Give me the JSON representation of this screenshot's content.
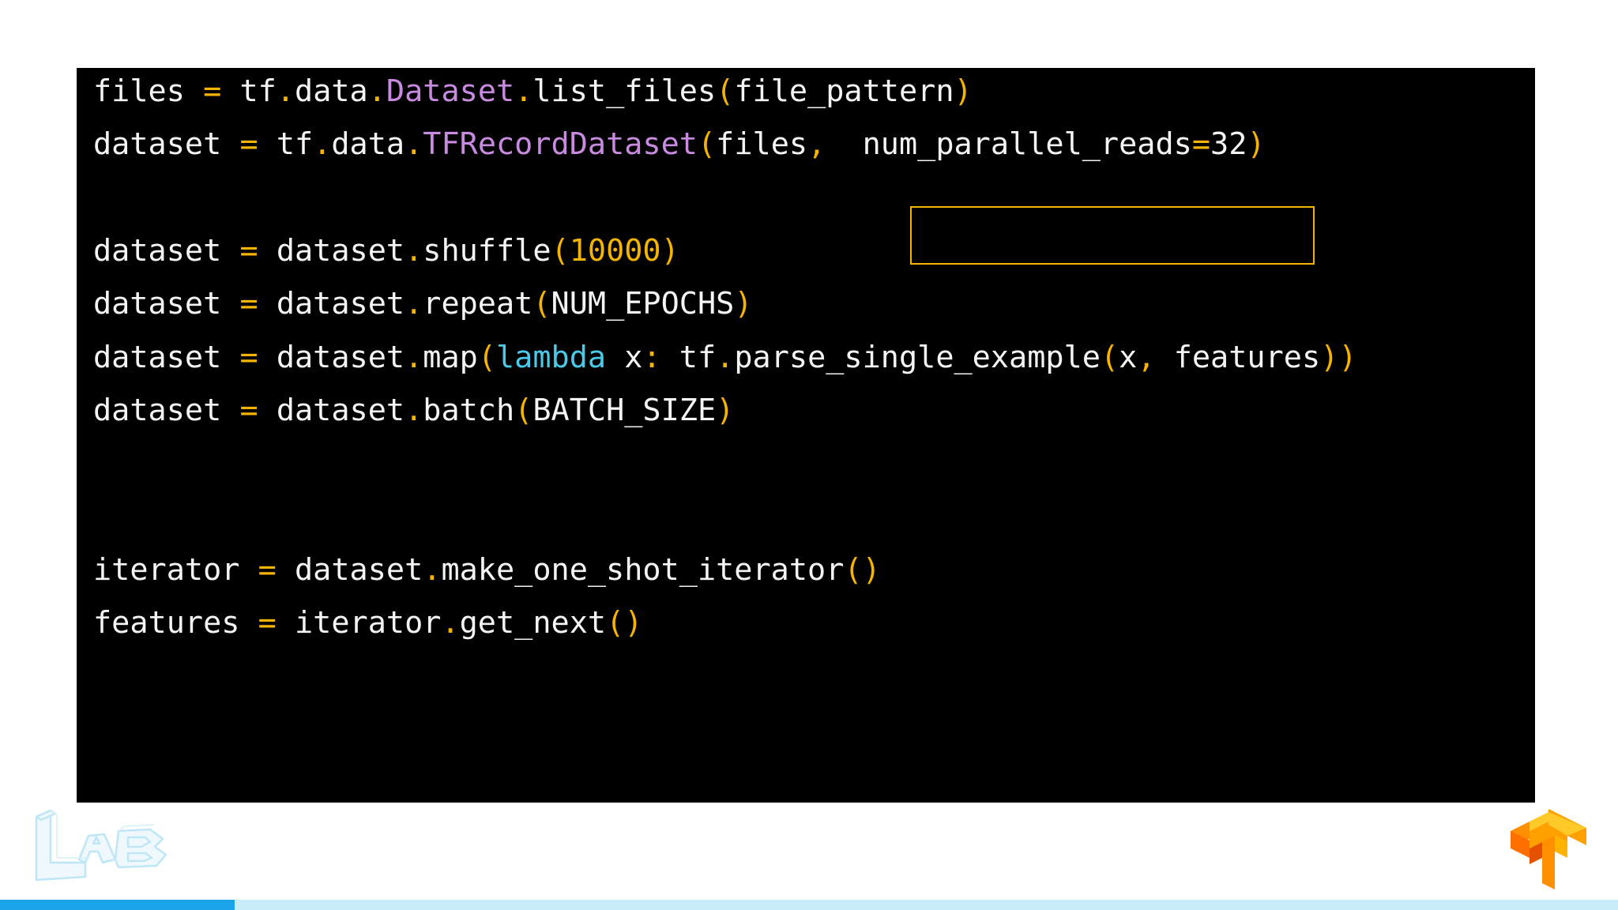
{
  "code": {
    "lines": [
      [
        {
          "t": "files",
          "c": "plain"
        },
        {
          "t": " ",
          "c": "plain"
        },
        {
          "t": "=",
          "c": "op"
        },
        {
          "t": " tf",
          "c": "plain"
        },
        {
          "t": ".",
          "c": "op"
        },
        {
          "t": "data",
          "c": "plain"
        },
        {
          "t": ".",
          "c": "op"
        },
        {
          "t": "Dataset",
          "c": "cls"
        },
        {
          "t": ".",
          "c": "op"
        },
        {
          "t": "list_files",
          "c": "plain"
        },
        {
          "t": "(",
          "c": "op"
        },
        {
          "t": "file_pattern",
          "c": "plain"
        },
        {
          "t": ")",
          "c": "op"
        }
      ],
      [
        {
          "t": "dataset",
          "c": "plain"
        },
        {
          "t": " ",
          "c": "plain"
        },
        {
          "t": "=",
          "c": "op"
        },
        {
          "t": " tf",
          "c": "plain"
        },
        {
          "t": ".",
          "c": "op"
        },
        {
          "t": "data",
          "c": "plain"
        },
        {
          "t": ".",
          "c": "op"
        },
        {
          "t": "TFRecordDataset",
          "c": "cls"
        },
        {
          "t": "(",
          "c": "op"
        },
        {
          "t": "files",
          "c": "plain"
        },
        {
          "t": ",",
          "c": "op"
        },
        {
          "t": "  num_parallel_reads",
          "c": "plain"
        },
        {
          "t": "=",
          "c": "op"
        },
        {
          "t": "32",
          "c": "plain"
        },
        {
          "t": ")",
          "c": "op"
        }
      ],
      [],
      [
        {
          "t": "dataset",
          "c": "plain"
        },
        {
          "t": " ",
          "c": "plain"
        },
        {
          "t": "=",
          "c": "op"
        },
        {
          "t": " dataset",
          "c": "plain"
        },
        {
          "t": ".",
          "c": "op"
        },
        {
          "t": "shuffle",
          "c": "plain"
        },
        {
          "t": "(",
          "c": "op"
        },
        {
          "t": "10000",
          "c": "num"
        },
        {
          "t": ")",
          "c": "op"
        }
      ],
      [
        {
          "t": "dataset",
          "c": "plain"
        },
        {
          "t": " ",
          "c": "plain"
        },
        {
          "t": "=",
          "c": "op"
        },
        {
          "t": " dataset",
          "c": "plain"
        },
        {
          "t": ".",
          "c": "op"
        },
        {
          "t": "repeat",
          "c": "plain"
        },
        {
          "t": "(",
          "c": "op"
        },
        {
          "t": "NUM_EPOCHS",
          "c": "plain"
        },
        {
          "t": ")",
          "c": "op"
        }
      ],
      [
        {
          "t": "dataset",
          "c": "plain"
        },
        {
          "t": " ",
          "c": "plain"
        },
        {
          "t": "=",
          "c": "op"
        },
        {
          "t": " dataset",
          "c": "plain"
        },
        {
          "t": ".",
          "c": "op"
        },
        {
          "t": "map",
          "c": "plain"
        },
        {
          "t": "(",
          "c": "op"
        },
        {
          "t": "lambda",
          "c": "kw"
        },
        {
          "t": " x",
          "c": "plain"
        },
        {
          "t": ":",
          "c": "op"
        },
        {
          "t": " tf",
          "c": "plain"
        },
        {
          "t": ".",
          "c": "op"
        },
        {
          "t": "parse_single_example",
          "c": "plain"
        },
        {
          "t": "(",
          "c": "op"
        },
        {
          "t": "x",
          "c": "plain"
        },
        {
          "t": ",",
          "c": "op"
        },
        {
          "t": " features",
          "c": "plain"
        },
        {
          "t": "))",
          "c": "op"
        }
      ],
      [
        {
          "t": "dataset",
          "c": "plain"
        },
        {
          "t": " ",
          "c": "plain"
        },
        {
          "t": "=",
          "c": "op"
        },
        {
          "t": " dataset",
          "c": "plain"
        },
        {
          "t": ".",
          "c": "op"
        },
        {
          "t": "batch",
          "c": "plain"
        },
        {
          "t": "(",
          "c": "op"
        },
        {
          "t": "BATCH_SIZE",
          "c": "plain"
        },
        {
          "t": ")",
          "c": "op"
        }
      ],
      [],
      [],
      [
        {
          "t": "iterator",
          "c": "plain"
        },
        {
          "t": " ",
          "c": "plain"
        },
        {
          "t": "=",
          "c": "op"
        },
        {
          "t": " dataset",
          "c": "plain"
        },
        {
          "t": ".",
          "c": "op"
        },
        {
          "t": "make_one_shot_iterator",
          "c": "plain"
        },
        {
          "t": "()",
          "c": "op"
        }
      ],
      [
        {
          "t": "features",
          "c": "plain"
        },
        {
          "t": " ",
          "c": "plain"
        },
        {
          "t": "=",
          "c": "op"
        },
        {
          "t": " iterator",
          "c": "plain"
        },
        {
          "t": ".",
          "c": "op"
        },
        {
          "t": "get_next",
          "c": "plain"
        },
        {
          "t": "()",
          "c": "op"
        }
      ]
    ]
  },
  "colors": {
    "plain": "#f4f4f4",
    "op": "#f4b400",
    "cls": "#c98be0",
    "kw": "#4cc9e8",
    "num": "#f4b400",
    "highlight_border": "#f4b400",
    "progress_fill": "#1aa3e8",
    "progress_track": "#c9ecfb"
  },
  "icons": {
    "left_logo": "lab-logo",
    "right_logo": "tensorflow-logo"
  },
  "progress": {
    "fraction": 0.145
  }
}
